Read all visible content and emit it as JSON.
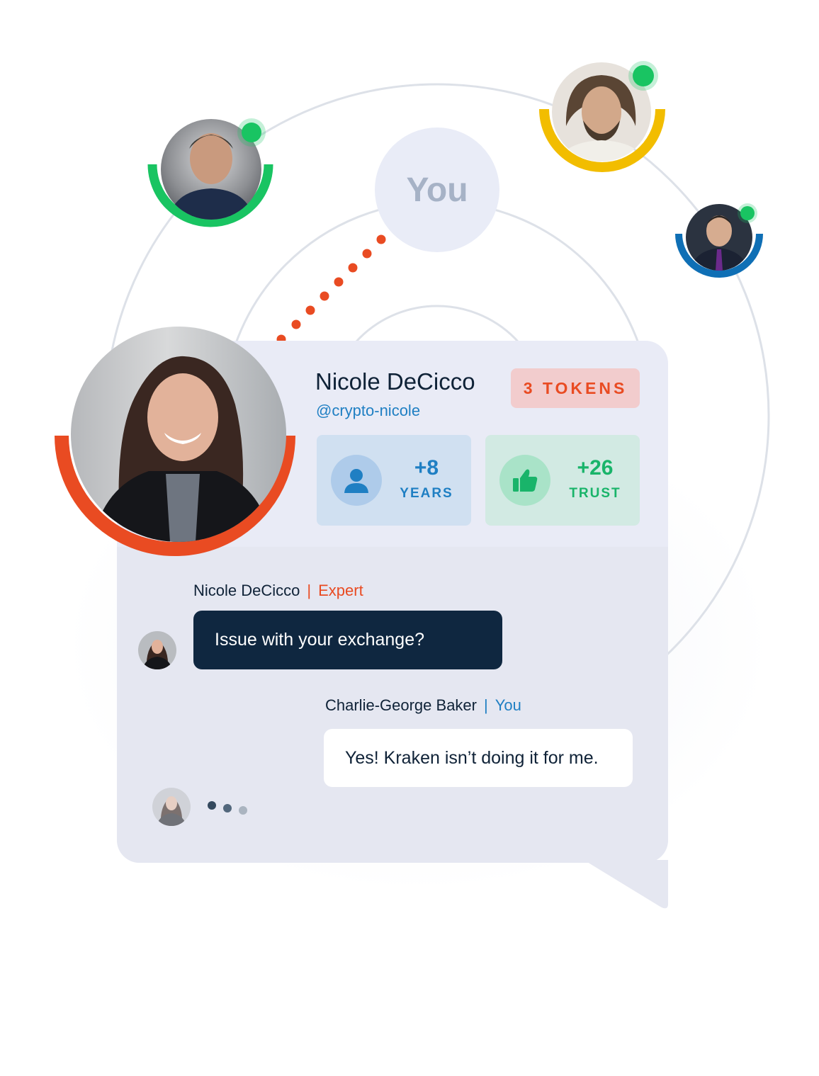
{
  "orbit": {
    "center_label": "You"
  },
  "profile": {
    "name": "Nicole DeCicco",
    "handle": "@crypto-nicole",
    "tokens_badge": "3 TOKENS",
    "stats": [
      {
        "value": "+8",
        "label": "YEARS",
        "icon": "user-icon"
      },
      {
        "value": "+26",
        "label": "TRUST",
        "icon": "thumbs-up-icon"
      }
    ]
  },
  "chat": {
    "messages": [
      {
        "sender": "Nicole DeCicco",
        "separator": "|",
        "role": "Expert",
        "text": "Issue with your exchange?"
      },
      {
        "sender": "Charlie-George Baker",
        "separator": "|",
        "role": "You",
        "text": "Yes! Kraken isn’t doing it for me."
      }
    ],
    "typing_indicator": "typing-dots"
  },
  "colors": {
    "accent_orange": "#e94b22",
    "accent_blue": "#1f7fc3",
    "accent_green": "#19c462",
    "ring_yellow": "#f2bd00",
    "ring_blue": "#0f6fb5",
    "dark_bubble": "#0f2740"
  }
}
